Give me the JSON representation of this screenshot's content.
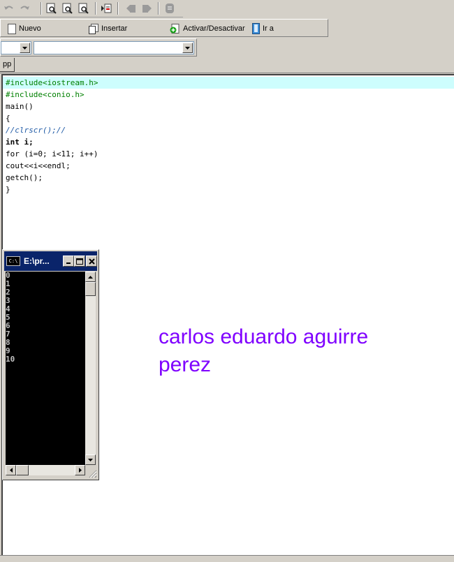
{
  "toolbar": {
    "actions": [
      {
        "label": "Nuevo",
        "icon": "new-doc-icon"
      },
      {
        "label": "Insertar",
        "icon": "insert-icon"
      },
      {
        "label": "Activar/Desactivar",
        "icon": "toggle-bookmark-icon"
      },
      {
        "label": "Ir a",
        "icon": "goto-icon"
      }
    ]
  },
  "combos": {
    "first": "",
    "second": ""
  },
  "tab": {
    "label": "pp"
  },
  "editor": {
    "lines": [
      "#include<iostream.h>",
      "#include<conio.h>",
      "main()",
      "{",
      "//clrscr();//",
      "int i;",
      "for (i=0; i<11; i++)",
      "cout<<i<<endl;",
      "getch();",
      "}"
    ]
  },
  "console": {
    "title": "E:\\pr...",
    "output": [
      "0",
      "1",
      "2",
      "3",
      "4",
      "5",
      "6",
      "7",
      "8",
      "9",
      "10"
    ]
  },
  "annotation": {
    "line1": "carlos eduardo aguirre",
    "line2": "perez"
  },
  "colors": {
    "annotation": "#7f00ff",
    "highlight_line": "#cdfdfd",
    "directive": "#008000",
    "comment": "#1f5aa6",
    "titlebar": "#0a246a"
  }
}
